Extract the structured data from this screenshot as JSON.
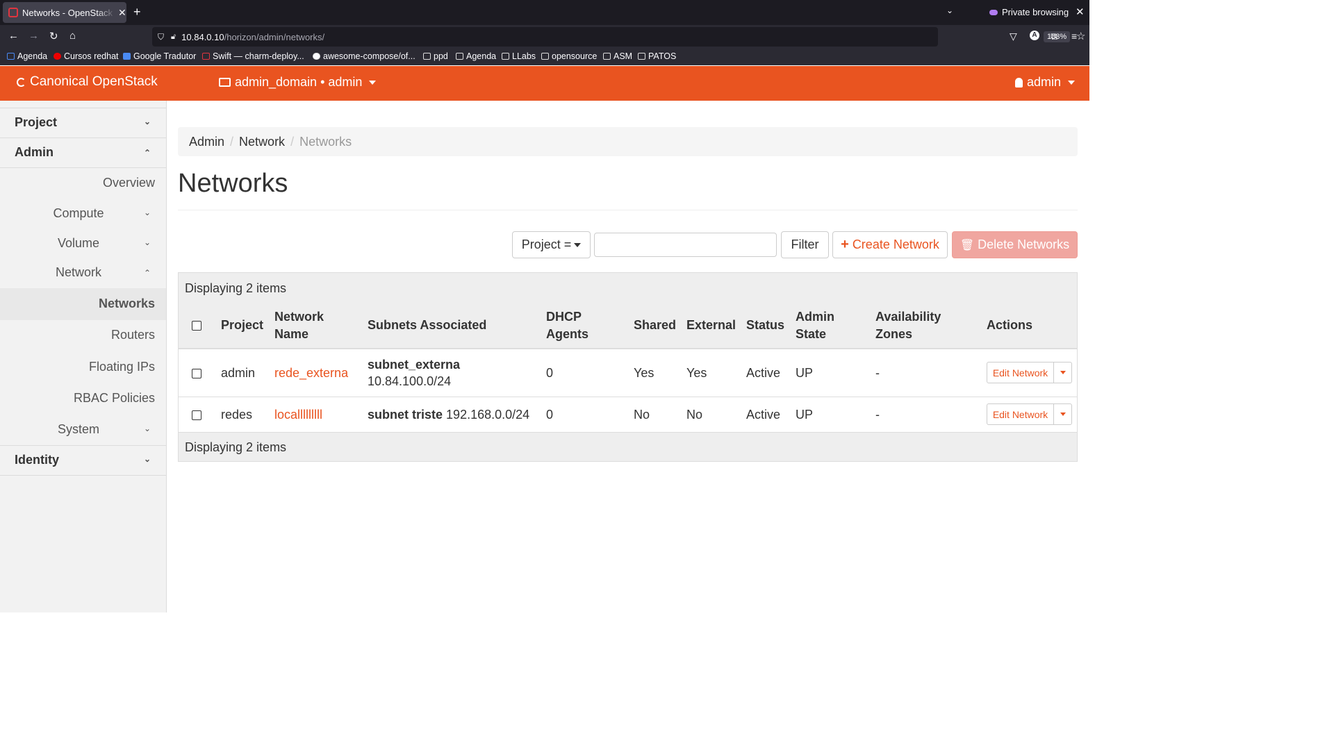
{
  "browser": {
    "tab_title": "Networks - OpenStack Dashboard",
    "new_tab": "+",
    "private_label": "Private browsing",
    "url_host": "10.84.0.10",
    "url_path": "/horizon/admin/networks/",
    "zoom": "133%",
    "bookmarks": [
      "Agenda",
      "Cursos redhat",
      "Google Tradutor",
      "Swift — charm-deploy...",
      "awesome-compose/of...",
      "ppd",
      "Agenda",
      "LLabs",
      "opensource",
      "ASM",
      "PATOS"
    ]
  },
  "header": {
    "brand": "Canonical OpenStack",
    "context": "admin_domain • admin",
    "user": "admin"
  },
  "sidebar": {
    "project": "Project",
    "admin": "Admin",
    "overview": "Overview",
    "compute": "Compute",
    "volume": "Volume",
    "network": "Network",
    "networks": "Networks",
    "routers": "Routers",
    "floating_ips": "Floating IPs",
    "rbac": "RBAC Policies",
    "system": "System",
    "identity": "Identity"
  },
  "breadcrumb": {
    "admin": "Admin",
    "network": "Network",
    "current": "Networks"
  },
  "page_title": "Networks",
  "toolbar": {
    "filter_select": "Project =",
    "filter_button": "Filter",
    "create_button": "Create Network",
    "delete_button": "Delete Networks"
  },
  "table": {
    "count_text": "Displaying 2 items",
    "headers": {
      "project": "Project",
      "network_name_1": "Network",
      "network_name_2": "Name",
      "subnets": "Subnets Associated",
      "dhcp_1": "DHCP",
      "dhcp_2": "Agents",
      "shared": "Shared",
      "external": "External",
      "status": "Status",
      "admin_state_1": "Admin",
      "admin_state_2": "State",
      "az_1": "Availability",
      "az_2": "Zones",
      "actions": "Actions"
    },
    "rows": [
      {
        "project": "admin",
        "name": "rede_externa",
        "subnet_name": "subnet_externa",
        "subnet_cidr": "10.84.100.0/24",
        "dhcp": "0",
        "shared": "Yes",
        "external": "Yes",
        "status": "Active",
        "admin_state": "UP",
        "az": "-",
        "action": "Edit Network"
      },
      {
        "project": "redes",
        "name": "localllllllll",
        "subnet_name": "subnet triste",
        "subnet_cidr": "192.168.0.0/24",
        "dhcp": "0",
        "shared": "No",
        "external": "No",
        "status": "Active",
        "admin_state": "UP",
        "az": "-",
        "action": "Edit Network"
      }
    ]
  }
}
